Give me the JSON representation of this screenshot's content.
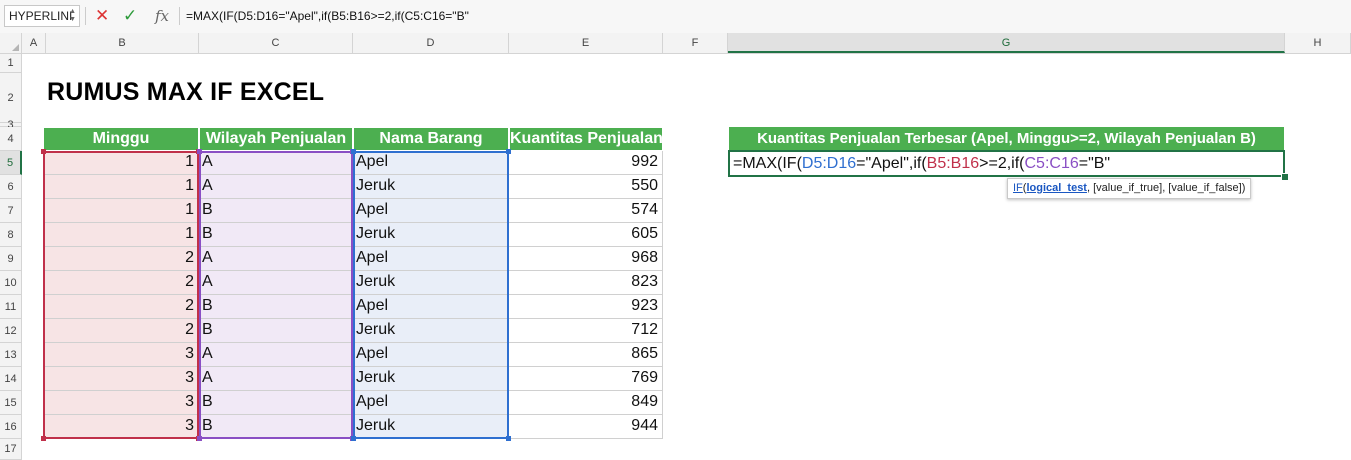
{
  "formula_bar": {
    "name_box": "HYPERLINI",
    "cancel_icon": "✕",
    "enter_icon": "✓",
    "fx_label": "fx",
    "formula": "=MAX(IF(D5:D16=\"Apel\",if(B5:B16>=2,if(C5:C16=\"B\""
  },
  "columns": [
    "A",
    "B",
    "C",
    "D",
    "E",
    "F",
    "G",
    "H"
  ],
  "rows": [
    "1",
    "2",
    "3",
    "4",
    "5",
    "6",
    "7",
    "8",
    "9",
    "10",
    "11",
    "12",
    "13",
    "14",
    "15",
    "16",
    "17"
  ],
  "sheet_title": "RUMUS MAX IF EXCEL",
  "table": {
    "headers": [
      "Minggu",
      "Wilayah Penjualan",
      "Nama Barang",
      "Kuantitas Penjualan"
    ],
    "rows": [
      [
        "1",
        "A",
        "Apel",
        "992"
      ],
      [
        "1",
        "A",
        "Jeruk",
        "550"
      ],
      [
        "1",
        "B",
        "Apel",
        "574"
      ],
      [
        "1",
        "B",
        "Jeruk",
        "605"
      ],
      [
        "2",
        "A",
        "Apel",
        "968"
      ],
      [
        "2",
        "A",
        "Jeruk",
        "823"
      ],
      [
        "2",
        "B",
        "Apel",
        "923"
      ],
      [
        "2",
        "B",
        "Jeruk",
        "712"
      ],
      [
        "3",
        "A",
        "Apel",
        "865"
      ],
      [
        "3",
        "A",
        "Jeruk",
        "769"
      ],
      [
        "3",
        "B",
        "Apel",
        "849"
      ],
      [
        "3",
        "B",
        "Jeruk",
        "944"
      ]
    ]
  },
  "result": {
    "header": "Kuantitas Penjualan Terbesar (Apel, Minggu>=2, Wilayah Penjualan B)",
    "formula_parts": [
      {
        "text": "=MAX(IF(",
        "color": "#111111"
      },
      {
        "text": "D5:D16",
        "color": "#2f6fd0"
      },
      {
        "text": "=\"Apel\",if(",
        "color": "#111111"
      },
      {
        "text": "B5:B16",
        "color": "#c0304a"
      },
      {
        "text": ">=2,if(",
        "color": "#111111"
      },
      {
        "text": "C5:C16",
        "color": "#8a4fc4"
      },
      {
        "text": "=\"B\"",
        "color": "#111111"
      }
    ]
  },
  "tooltip": {
    "fn": "IF",
    "open": "(",
    "arg1": "logical_test",
    "rest": ", [value_if_true], [value_if_false])"
  },
  "colors": {
    "header_green": "#4caf50",
    "range_b": "#c0304a",
    "range_c": "#8a4fc4",
    "range_d": "#2f6fd0",
    "selection": "#217346"
  }
}
